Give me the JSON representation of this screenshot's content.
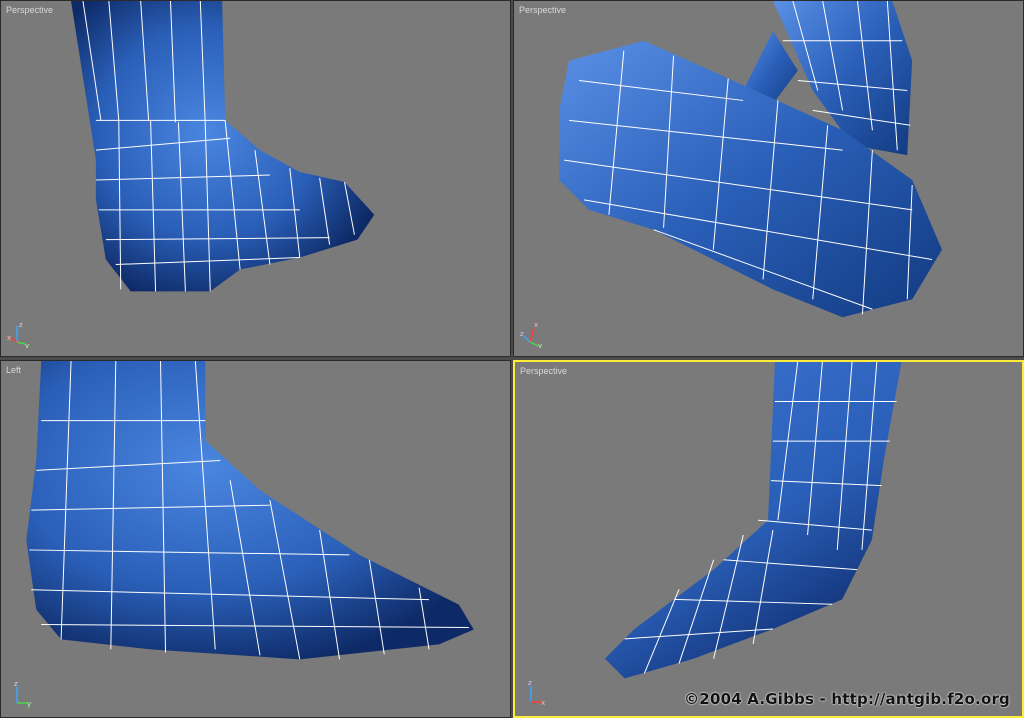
{
  "viewports": [
    {
      "label": "Perspective",
      "active": false
    },
    {
      "label": "Perspective",
      "active": false
    },
    {
      "label": "Left",
      "active": false
    },
    {
      "label": "Perspective",
      "active": true
    }
  ],
  "axis": {
    "x": "x",
    "y": "y",
    "z": "z"
  },
  "watermark": "©2004 A.Gibbs - http://antgib.f2o.org",
  "colors": {
    "mesh_blue": "#2a5fb8",
    "mesh_highlight": "#4a86e0",
    "viewport_bg": "#7a7a7a",
    "active_border": "#ffec3a"
  }
}
